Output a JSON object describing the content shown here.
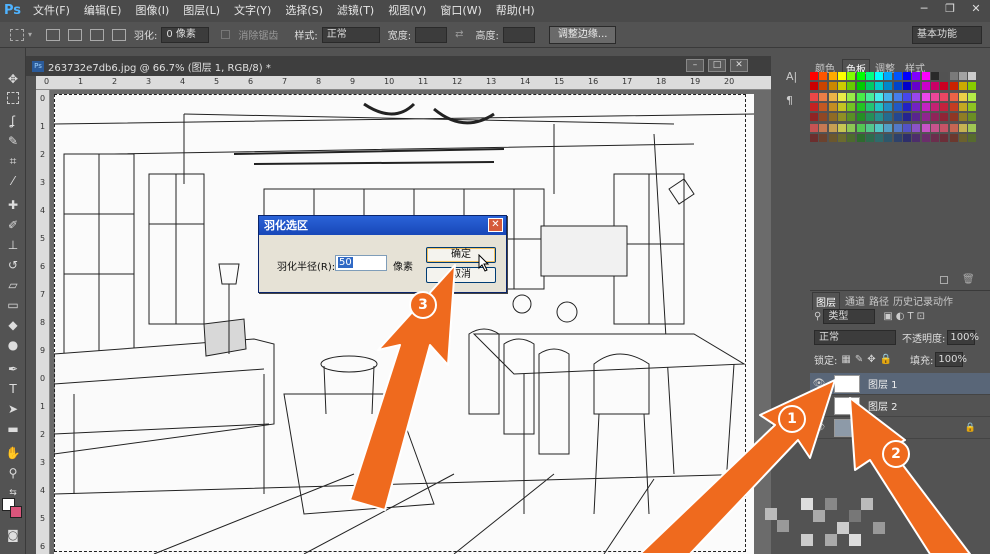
{
  "app": {
    "logo": "Ps"
  },
  "menu": [
    "文件(F)",
    "编辑(E)",
    "图像(I)",
    "图层(L)",
    "文字(Y)",
    "选择(S)",
    "滤镜(T)",
    "视图(V)",
    "窗口(W)",
    "帮助(H)"
  ],
  "options": {
    "feather_label": "羽化:",
    "feather_value": "0 像素",
    "antialias_label": "消除锯齿",
    "style_label": "样式:",
    "style_value": "正常",
    "width_label": "宽度:",
    "height_label": "高度:",
    "refine_edge": "调整边缘...",
    "workspace": "基本功能"
  },
  "document": {
    "tab_title": "263732e7db6.jpg @ 66.7% (图层 1, RGB/8) *",
    "ruler_top": [
      "0",
      "1",
      "2",
      "3",
      "4",
      "5",
      "6",
      "7",
      "8",
      "9",
      "10",
      "11",
      "12",
      "13",
      "14",
      "15",
      "16",
      "17",
      "18",
      "19",
      "20"
    ],
    "ruler_left": [
      "0",
      "1",
      "2",
      "3",
      "4",
      "5",
      "6",
      "7",
      "8",
      "9",
      "0",
      "1",
      "2",
      "3",
      "4",
      "5",
      "6"
    ]
  },
  "dialog": {
    "title": "羽化选区",
    "close": "✕",
    "radius_label": "羽化半径(R):",
    "radius_value": "50",
    "unit": "像素",
    "ok": "确定",
    "cancel": "取消"
  },
  "swatch_panel": {
    "tabs": [
      "颜色",
      "色板",
      "调整",
      "样式"
    ],
    "active_tab": "色板"
  },
  "layers_panel": {
    "tabs": [
      "图层",
      "通道",
      "路径",
      "历史记录",
      "动作"
    ],
    "filter": "类型",
    "blend_mode": "正常",
    "opacity_label": "不透明度:",
    "opacity_value": "100%",
    "lock_label": "锁定:",
    "fill_label": "填充:",
    "fill_value": "100%",
    "layers": [
      {
        "name": "图层 1",
        "selected": true
      },
      {
        "name": "图层 2",
        "selected": false
      },
      {
        "name": "",
        "selected": false
      }
    ]
  },
  "annotations": {
    "step1": "1",
    "step2": "2",
    "step3": "3"
  },
  "colors": {
    "accent_orange": "#ef6a1e",
    "xp_title": "#2a63d8",
    "selected_layer": "#596678"
  }
}
